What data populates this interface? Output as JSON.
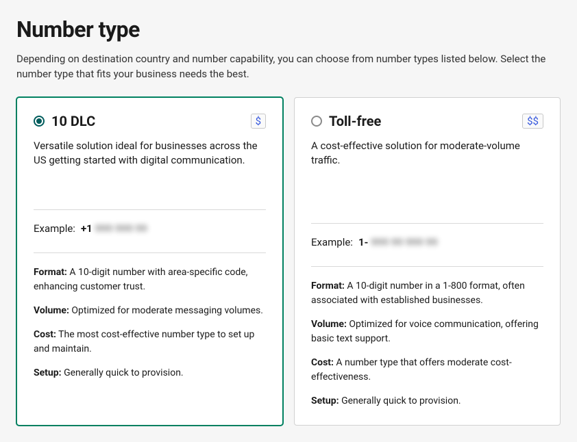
{
  "page": {
    "title": "Number type",
    "subtitle": "Depending on destination country and number capability, you can choose from number types listed below. Select the number type that fits your business needs the best."
  },
  "cards": [
    {
      "selected": true,
      "title": "10 DLC",
      "price": "$",
      "description": "Versatile solution ideal for businesses across the US getting started with digital communication.",
      "example_label": "Example:",
      "example_prefix": "+1",
      "example_blurred": "999 999 99",
      "details": {
        "format_label": "Format:",
        "format": "A 10-digit number with area-specific code, enhancing customer trust.",
        "volume_label": "Volume:",
        "volume": "Optimized for moderate messaging volumes.",
        "cost_label": "Cost:",
        "cost": "The most cost-effective number type to set up and maintain.",
        "setup_label": "Setup:",
        "setup": "Generally quick to provision."
      }
    },
    {
      "selected": false,
      "title": "Toll-free",
      "price": "$$",
      "description": "A cost-effective solution for moderate-volume traffic.",
      "example_label": "Example:",
      "example_prefix": "1-",
      "example_blurred": "999 99 999 99",
      "details": {
        "format_label": "Format:",
        "format": "A 10-digit number in a 1-800 format, often associated with established businesses.",
        "volume_label": "Volume:",
        "volume": "Optimized for voice communication, offering basic text support.",
        "cost_label": "Cost:",
        "cost": "A number type that offers moderate cost-effectiveness.",
        "setup_label": "Setup:",
        "setup": "Generally quick to provision."
      }
    }
  ]
}
